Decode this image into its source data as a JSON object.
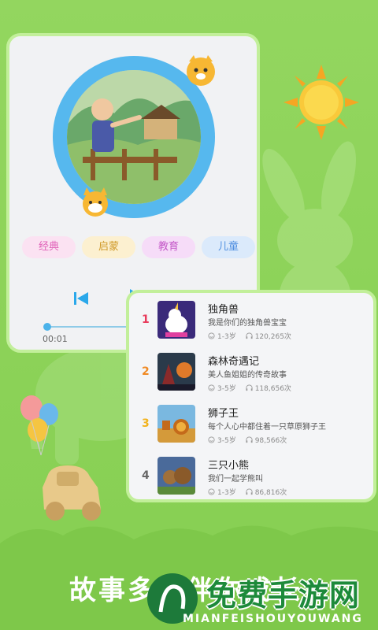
{
  "player": {
    "tags": [
      "经典",
      "启蒙",
      "教育",
      "儿童"
    ],
    "time": "00:01"
  },
  "stories": [
    {
      "rank": "1",
      "title": "独角兽",
      "desc": "我是你们的独角兽宝宝",
      "age": "1-3岁",
      "plays": "120,265次",
      "rank_color": "#e83a5a"
    },
    {
      "rank": "2",
      "title": "森林奇遇记",
      "desc": "美人鱼姐姐的传奇故事",
      "age": "3-5岁",
      "plays": "118,656次",
      "rank_color": "#f08a24"
    },
    {
      "rank": "3",
      "title": "狮子王",
      "desc": "每个人心中都住着一只草原狮子王",
      "age": "3-5岁",
      "plays": "98,566次",
      "rank_color": "#f2b31d"
    },
    {
      "rank": "4",
      "title": "三只小熊",
      "desc": "我们一起学熊叫",
      "age": "1-3岁",
      "plays": "86,816次",
      "rank_color": "#666666"
    }
  ],
  "footer": {
    "caption": "故事多多伴你成长",
    "brand": "免费手游网",
    "brand_en": "MIANFEISHOUYOUWANG"
  }
}
